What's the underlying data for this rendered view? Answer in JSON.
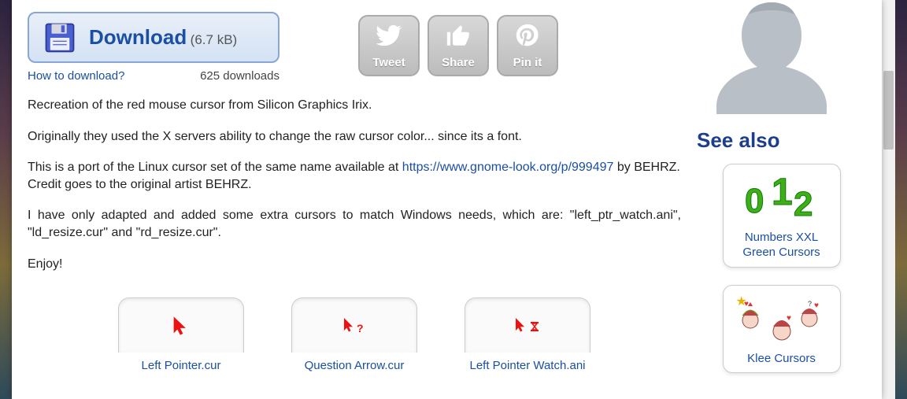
{
  "download": {
    "label": "Download",
    "size": "(6.7 kB)",
    "how_to": "How to download?",
    "count": "625 downloads"
  },
  "share": {
    "tweet": "Tweet",
    "share": "Share",
    "pinit": "Pin it"
  },
  "description": {
    "p1": "Recreation of the red mouse cursor from Silicon Graphics Irix.",
    "p2": "Originally they used the X servers ability to change the raw cursor color... since its a font.",
    "p3a": "This is a port of the Linux cursor set of the same name available at ",
    "p3_link": "https://www.gnome-look.org/p/999497",
    "p3b": " by BEHRZ. Credit goes to the original artist BEHRZ.",
    "p4": "I have only adapted and added some extra cursors to match Windows needs, which are: \"left_ptr_watch.ani\", \"ld_resize.cur\" and \"rd_resize.cur\".",
    "p5": "Enjoy!"
  },
  "cursors": [
    {
      "name": "Left Pointer.cur"
    },
    {
      "name": "Question Arrow.cur"
    },
    {
      "name": "Left Pointer Watch.ani"
    }
  ],
  "sidebar": {
    "see_also": "See also",
    "related": [
      {
        "label": "Numbers XXL Green Cursors"
      },
      {
        "label": "Klee Cursors"
      }
    ]
  }
}
